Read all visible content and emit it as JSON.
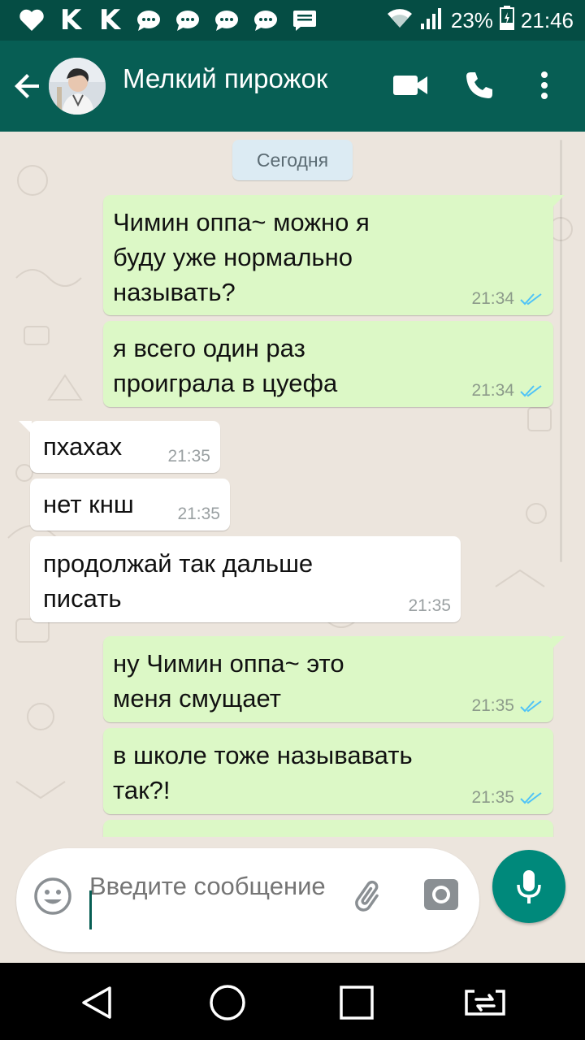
{
  "status_bar": {
    "notification_icons": [
      "heart-icon",
      "vk-icon",
      "vk-icon",
      "chat-icon",
      "chat-icon",
      "chat-icon",
      "chat-icon",
      "message-icon"
    ],
    "vk_label": "K",
    "battery": "23%",
    "time": "21:46"
  },
  "toolbar": {
    "contact_name": "Мелкий пирожок",
    "icons": [
      "back-arrow-icon",
      "video-call-icon",
      "phone-icon",
      "more-vert-icon"
    ],
    "color": "#075e54"
  },
  "chat": {
    "date_label": "Сегодня",
    "messages": [
      {
        "direction": "out",
        "lines": [
          "Чимин оппа~ можно я",
          "буду уже нормально",
          "называть?"
        ],
        "time": "21:34",
        "status": "read-double-check-icon"
      },
      {
        "direction": "out",
        "lines": [
          "я всего один раз",
          "проиграла в цуефа"
        ],
        "time": "21:34",
        "status": "read-double-check-icon"
      },
      {
        "direction": "in",
        "lines": [
          "пхахах"
        ],
        "time": "21:35"
      },
      {
        "direction": "in",
        "lines": [
          "нет кнш"
        ],
        "time": "21:35"
      },
      {
        "direction": "in",
        "lines": [
          "продолжай так дальше",
          "писать"
        ],
        "time": "21:35"
      },
      {
        "direction": "out",
        "lines": [
          "ну Чимин оппа~ это",
          "меня смущает"
        ],
        "time": "21:35",
        "status": "read-double-check-icon"
      },
      {
        "direction": "out",
        "lines": [
          "в школе тоже называвать",
          "так?!"
        ],
        "time": "21:35",
        "status": "read-double-check-icon"
      }
    ],
    "colors": {
      "outgoing": "#dcf8c6",
      "incoming": "#ffffff",
      "read_check": "#4fc3f7"
    }
  },
  "input_bar": {
    "placeholder": "Введите сообщение",
    "icons": [
      "emoji-icon",
      "paperclip-icon",
      "camera-icon",
      "mic-icon"
    ],
    "mic_color": "#00897b"
  },
  "nav_bar": {
    "icons": [
      "back-triangle-icon",
      "home-circle-icon",
      "recents-square-icon",
      "screen-mirror-icon"
    ]
  }
}
